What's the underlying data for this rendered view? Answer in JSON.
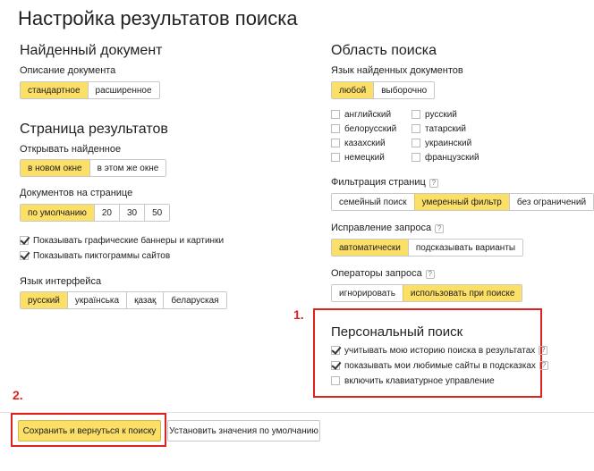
{
  "page_title": "Настройка результатов поиска",
  "found_document": {
    "title": "Найденный документ",
    "description_label": "Описание документа",
    "options": [
      "стандартное",
      "расширенное"
    ],
    "selected": 0
  },
  "results_page": {
    "title": "Страница результатов",
    "open_label": "Открывать найденное",
    "open_options": [
      "в новом окне",
      "в этом же окне"
    ],
    "docs_label": "Документов на странице",
    "docs_options": [
      "по умолчанию",
      "20",
      "30",
      "50"
    ],
    "show_banners": "Показывать графические баннеры и картинки",
    "show_icons": "Показывать пиктограммы сайтов"
  },
  "interface_language": {
    "label": "Язык интерфейса",
    "options": [
      "русский",
      "українська",
      "қазақ",
      "беларуская"
    ]
  },
  "search_area": {
    "title": "Область поиска",
    "lang_label": "Язык найденных документов",
    "lang_options": [
      "любой",
      "выборочно"
    ],
    "languages_left": [
      "английский",
      "белорусский",
      "казахский",
      "немецкий"
    ],
    "languages_right": [
      "русский",
      "татарский",
      "украинский",
      "французский"
    ],
    "filter_label": "Фильтрация страниц",
    "filter_options": [
      "семейный поиск",
      "умеренный фильтр",
      "без ограничений"
    ],
    "correction_label": "Исправление запроса",
    "correction_options": [
      "автоматически",
      "подсказывать варианты"
    ],
    "operators_label": "Операторы запроса",
    "operators_options": [
      "игнорировать",
      "использовать при поиске"
    ],
    "help": "?"
  },
  "personal_search": {
    "title": "Персональный поиск",
    "history": "учитывать мою историю поиска в результатах",
    "favorites": "показывать мои любимые сайты в подсказках",
    "keyboard": "включить клавиатурное управление"
  },
  "markers": {
    "one": "1.",
    "two": "2."
  },
  "footer": {
    "save": "Сохранить и вернуться к поиску",
    "defaults": "Установить значения по умолчанию"
  },
  "colors": {
    "accent": "#fcdf67",
    "annotation": "#e0221f"
  }
}
